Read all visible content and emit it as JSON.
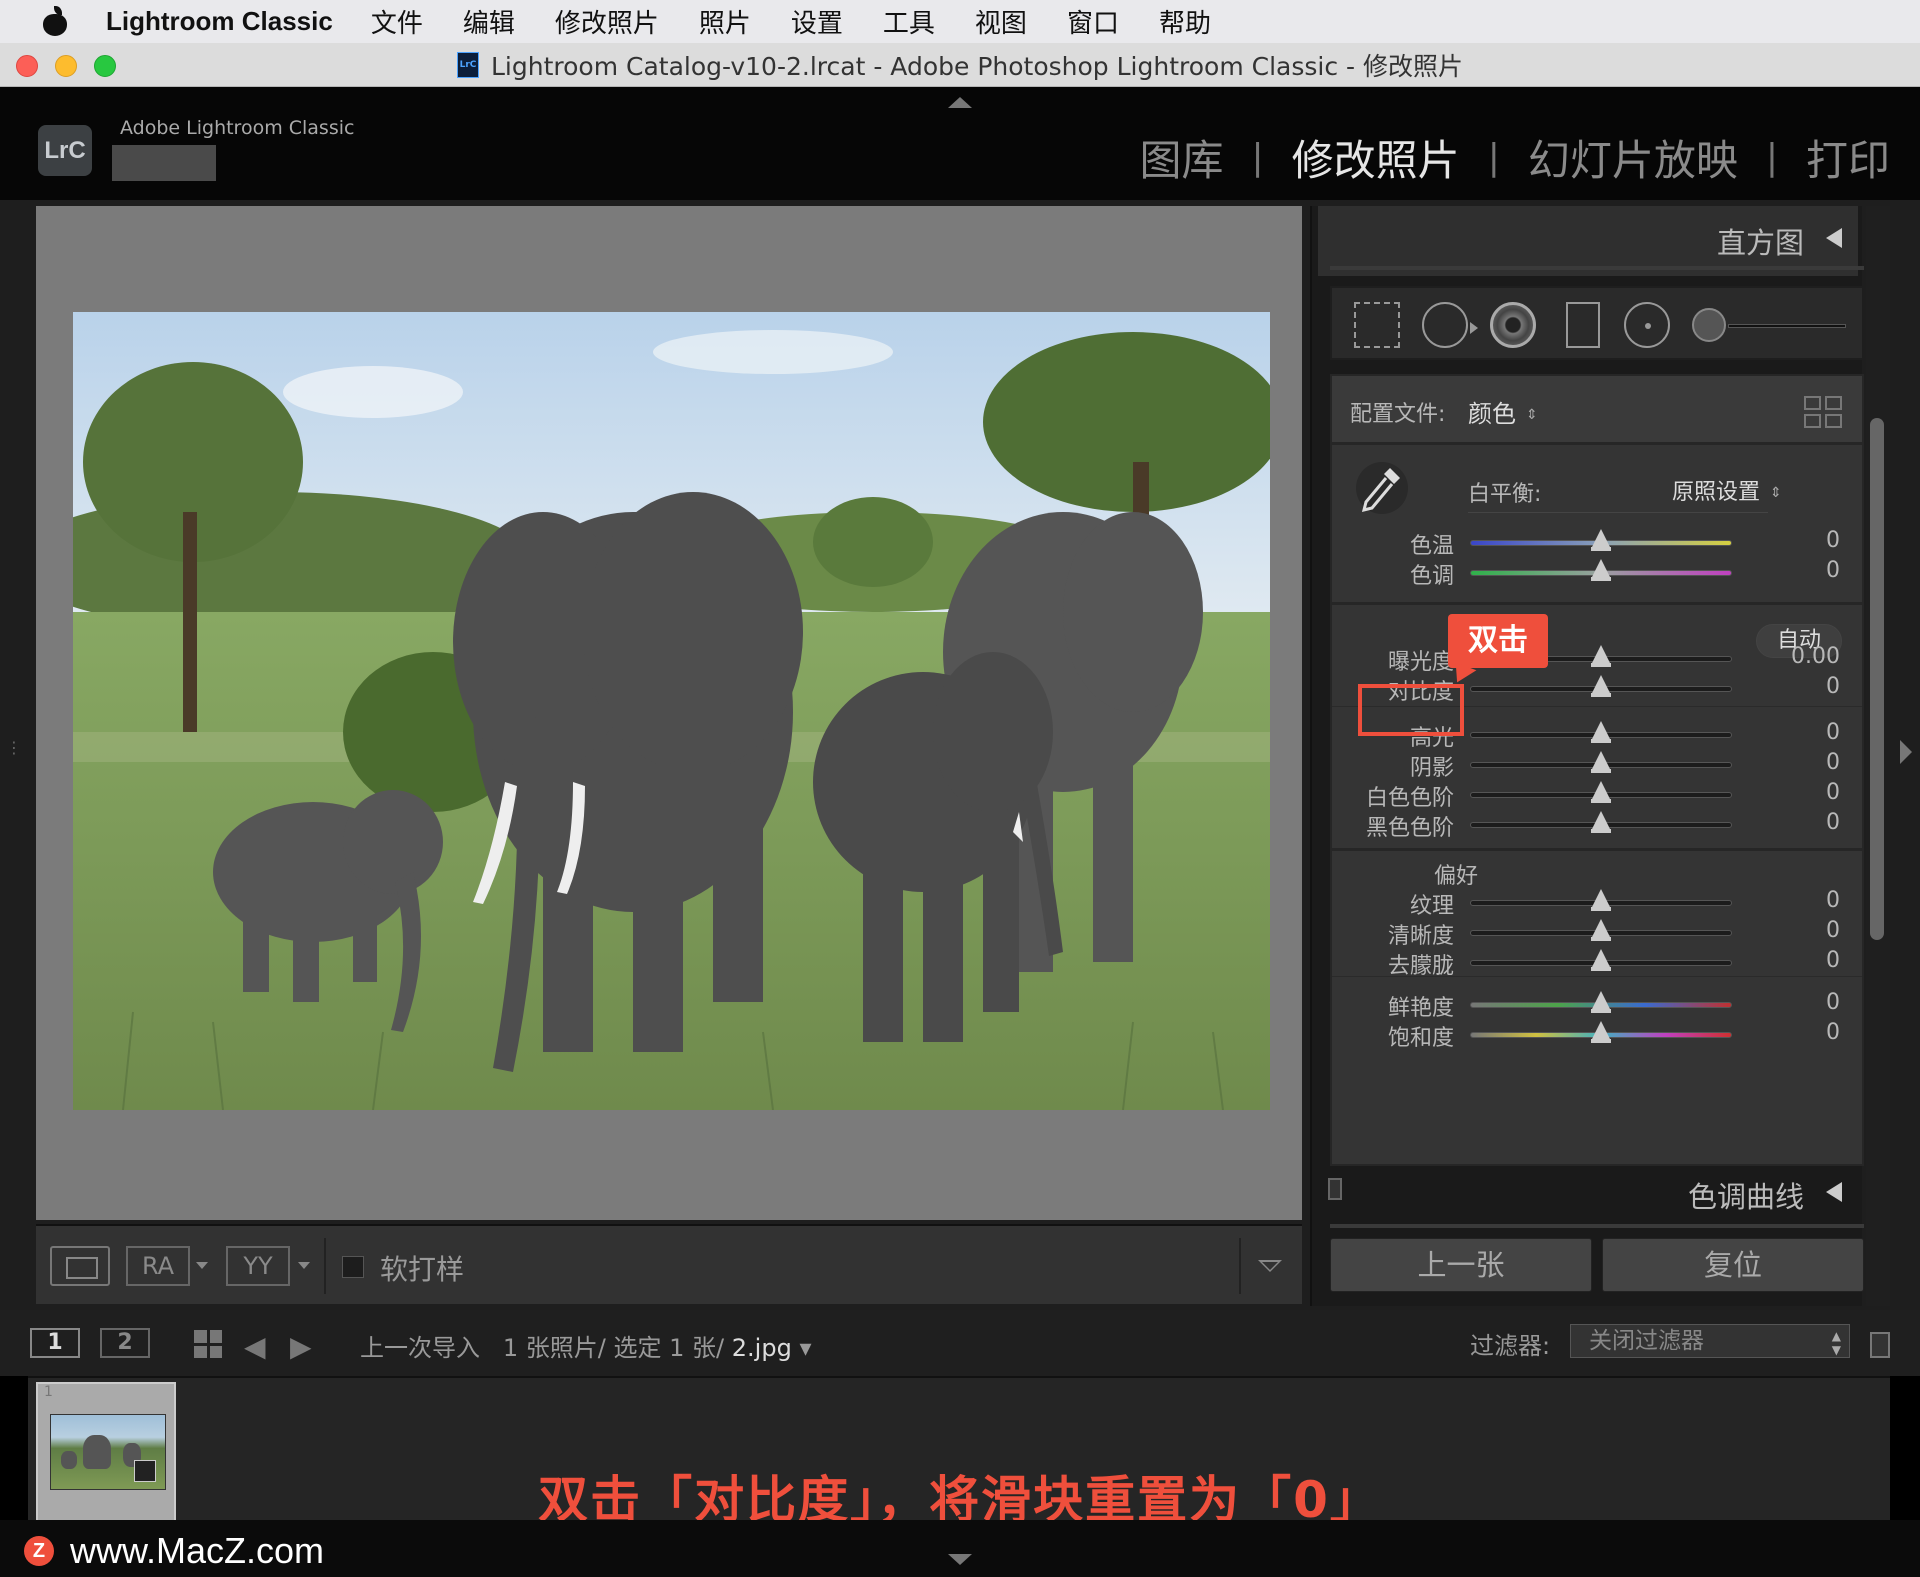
{
  "menubar": {
    "app_name": "Lightroom Classic",
    "items": [
      "文件",
      "编辑",
      "修改照片",
      "照片",
      "设置",
      "工具",
      "视图",
      "窗口",
      "帮助"
    ]
  },
  "window": {
    "title": "Lightroom Catalog-v10-2.lrcat - Adobe Photoshop Lightroom Classic - 修改照片",
    "doc_icon_text": "LrC"
  },
  "header": {
    "logo": "LrC",
    "brand": "Adobe Lightroom Classic",
    "modules": [
      {
        "label": "图库",
        "active": false
      },
      {
        "label": "修改照片",
        "active": true
      },
      {
        "label": "幻灯片放映",
        "active": false
      },
      {
        "label": "打印",
        "active": false
      }
    ]
  },
  "toolbar": {
    "ra_label": "RA",
    "yy_label": "YY",
    "soft_proof": "软打样"
  },
  "panel": {
    "histogram_title": "直方图",
    "profile_label": "配置文件:",
    "profile_value": "颜色",
    "wb_label": "白平衡:",
    "wb_value": "原照设置",
    "auto_label": "自动",
    "presence_label": "偏好",
    "tone_curve_title": "色调曲线",
    "prev_button": "上一张",
    "reset_button": "复位",
    "sliders": [
      {
        "label": "色温",
        "value": "0"
      },
      {
        "label": "色调",
        "value": "0"
      },
      {
        "label": "曝光度",
        "value": "0.00"
      },
      {
        "label": "对比度",
        "value": "0"
      },
      {
        "label": "高光",
        "value": "0"
      },
      {
        "label": "阴影",
        "value": "0"
      },
      {
        "label": "白色色阶",
        "value": "0"
      },
      {
        "label": "黑色色阶",
        "value": "0"
      },
      {
        "label": "纹理",
        "value": "0"
      },
      {
        "label": "清晰度",
        "value": "0"
      },
      {
        "label": "去朦胧",
        "value": "0"
      },
      {
        "label": "鲜艳度",
        "value": "0"
      },
      {
        "label": "饱和度",
        "value": "0"
      }
    ]
  },
  "annotation": {
    "tag": "双击",
    "caption": "双击「对比度」，将滑块重置为「0」",
    "color": "#ef4f3c"
  },
  "filmbar": {
    "view1": "1",
    "view2": "2",
    "source": "上一次导入",
    "count": "1 张照片/ 选定 1 张/",
    "file": "2.jpg",
    "filter_label": "过滤器:",
    "filter_value": "关闭过滤器"
  },
  "filmstrip": {
    "thumb_number": "1"
  },
  "watermark": "www.MacZ.com"
}
